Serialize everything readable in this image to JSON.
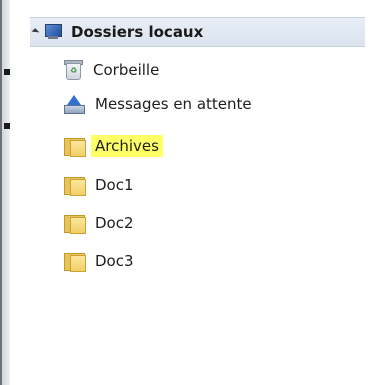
{
  "tree": {
    "root": {
      "label": "Dossiers locaux",
      "icon": "monitor-icon",
      "expanded": true
    },
    "items": [
      {
        "label": "Corbeille",
        "icon": "trash-icon",
        "highlighted": false
      },
      {
        "label": "Messages en attente",
        "icon": "outbox-icon",
        "highlighted": false
      },
      {
        "label": "Archives",
        "icon": "folder-icon",
        "highlighted": true
      },
      {
        "label": "Doc1",
        "icon": "folder-icon",
        "highlighted": false
      },
      {
        "label": "Doc2",
        "icon": "folder-icon",
        "highlighted": false
      },
      {
        "label": "Doc3",
        "icon": "folder-icon",
        "highlighted": false
      }
    ]
  },
  "colors": {
    "highlight": "#ffff66",
    "root_background": "#dbe3ee",
    "folder": "#f1cf66"
  }
}
